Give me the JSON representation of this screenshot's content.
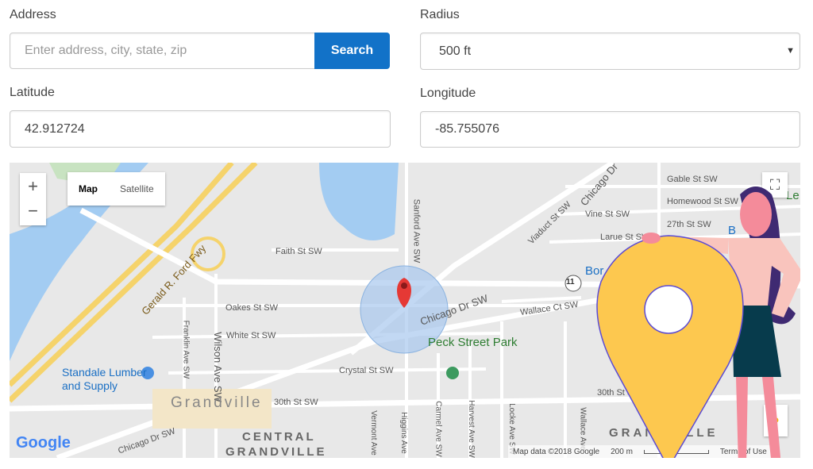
{
  "form": {
    "address_label": "Address",
    "address_placeholder": "Enter address, city, state, zip",
    "search_label": "Search",
    "radius_label": "Radius",
    "radius_value": "500 ft",
    "latitude_label": "Latitude",
    "latitude_value": "42.912724",
    "longitude_label": "Longitude",
    "longitude_value": "-85.755076"
  },
  "map": {
    "zoom_in": "+",
    "zoom_out": "−",
    "type_map": "Map",
    "type_satellite": "Satellite",
    "streets": [
      "Gerald R. Ford Fwy",
      "Faith St SW",
      "Oakes St SW",
      "White St SW",
      "Crystal St SW",
      "30th St SW",
      "Chicago Dr SW",
      "Chicago Dr SW",
      "Chicago Dr",
      "Viaduct St SW",
      "Gable St SW",
      "Homewood St SW",
      "Vine St SW",
      "27th St SW",
      "Larue St SW",
      "Wallace Ct SW",
      "Sanford Ave SW",
      "Wilson Ave SW",
      "Franklin Ave SW",
      "Vermont Ave",
      "Higgins Ave",
      "Carmel Ave SW",
      "Harvest Ave SW",
      "Locke Ave SW",
      "Wallace Ave",
      "30th St SW"
    ],
    "places": {
      "peck_park": "Peck Street Park",
      "standale": "Standale Lumber and Supply",
      "grandville": "Grandville",
      "central": "CENTRAL",
      "central2": "GRANDVILLE",
      "grandville_area": "GRANDVILLE",
      "bor": "Bor",
      "le": "Le",
      "baker": "B        ker"
    },
    "route_shield": "11",
    "google_logo": "Google",
    "attribution": "Map data ©2018 Google",
    "scale": "200 m",
    "terms": "Terms of Use",
    "colors": {
      "water": "#a3ccf2",
      "highway": "#f5d36b",
      "circle": "#a8c8ee",
      "marker": "#e53935",
      "pin": "#fdc84f"
    }
  }
}
